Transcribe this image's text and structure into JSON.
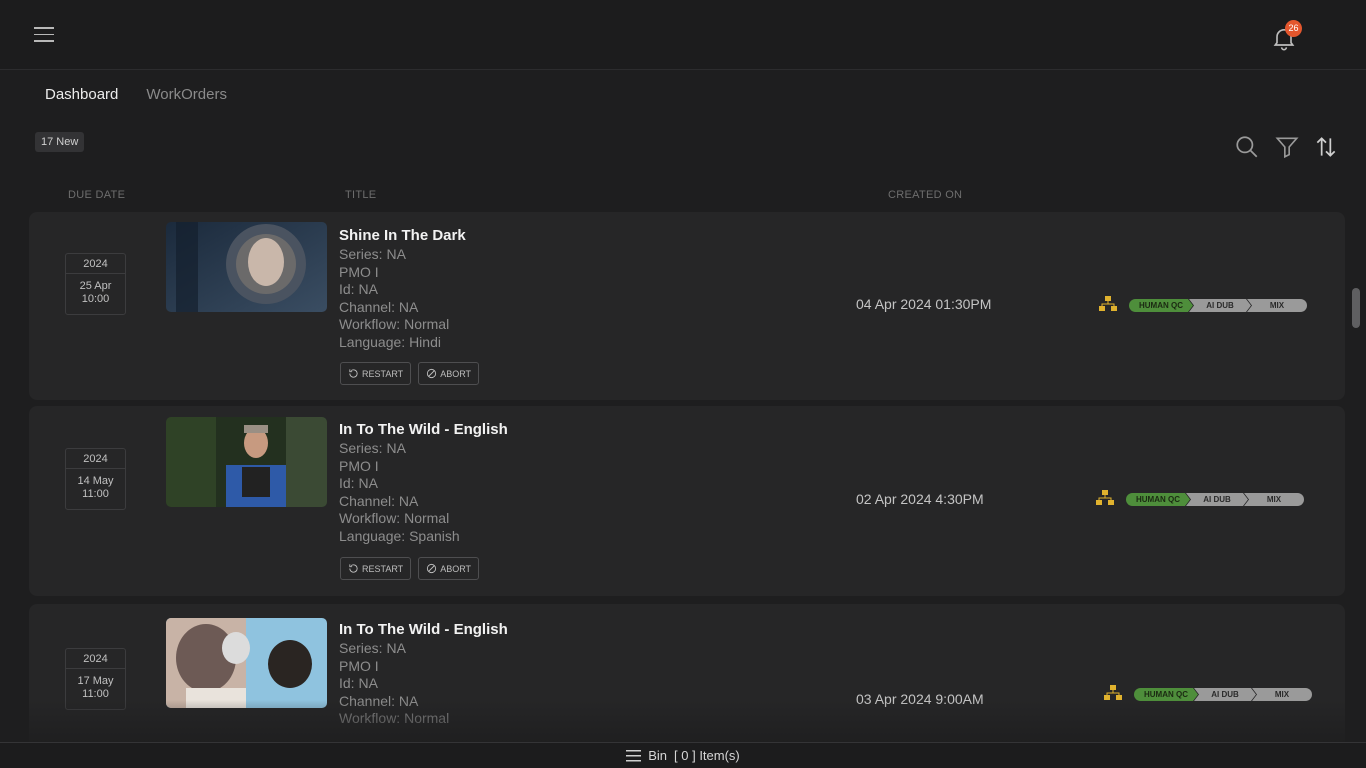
{
  "header": {
    "notification_count": "26"
  },
  "tabs": [
    {
      "label": "Dashboard"
    },
    {
      "label": "WorkOrders"
    }
  ],
  "new_count": "17 New",
  "columns": {
    "due_date": "DUE DATE",
    "title": "TITLE",
    "created_on": "CREATED ON"
  },
  "actions": {
    "restart": "RESTART",
    "abort": "ABORT"
  },
  "pipeline": [
    "HUMAN QC",
    "AI DUB",
    "MIX"
  ],
  "colors": {
    "accent_badge": "#e4572e",
    "stage_active": "#4e8e3b",
    "stage_pending": "#9a9a9a",
    "workflow_icon": "#e0b22e"
  },
  "orders": [
    {
      "year": "2024",
      "day_month": "25 Apr",
      "time": "10:00",
      "title": "Shine In The Dark",
      "series": "Series: NA",
      "pmo": "PMO I",
      "id": "Id: NA",
      "channel": "Channel: NA",
      "workflow": "Workflow: Normal",
      "language": "Language: Hindi",
      "created": "04 Apr 2024 01:30PM"
    },
    {
      "year": "2024",
      "day_month": "14 May",
      "time": "11:00",
      "title": "In To The Wild - English",
      "series": "Series: NA",
      "pmo": "PMO I",
      "id": "Id: NA",
      "channel": "Channel: NA",
      "workflow": "Workflow: Normal",
      "language": "Language: Spanish",
      "created": "02 Apr 2024 4:30PM"
    },
    {
      "year": "2024",
      "day_month": "17 May",
      "time": "11:00",
      "title": "In To The Wild - English",
      "series": "Series: NA",
      "pmo": "PMO I",
      "id": "Id: NA",
      "channel": "Channel: NA",
      "workflow": "Workflow: Normal",
      "language": "",
      "created": "03 Apr 2024 9:00AM"
    }
  ],
  "bin": {
    "label": "Bin",
    "count_text": "[ 0 ] Item(s)"
  }
}
